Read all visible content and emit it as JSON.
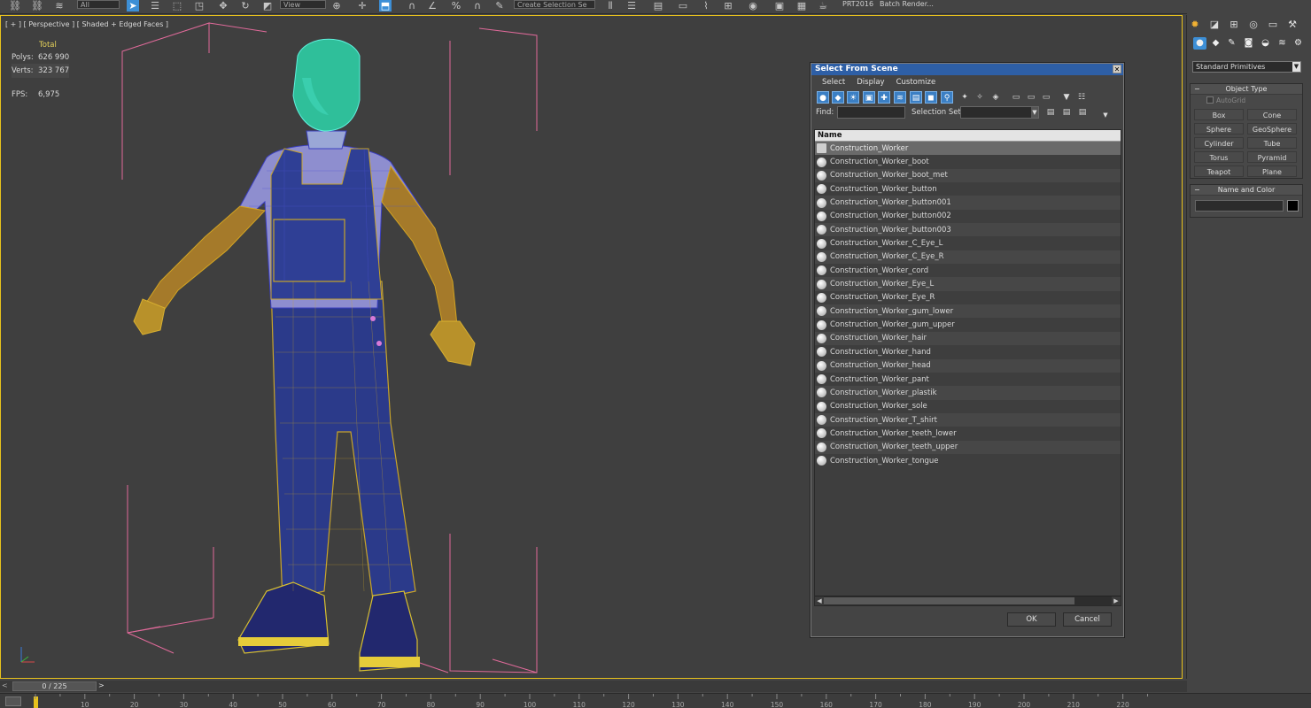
{
  "toolbar": {
    "filter_combo": "All",
    "view_combo": "View",
    "selection_set_combo": "Create Selection Se",
    "render_preset": "PRT2016",
    "batch_render": "Batch Render..."
  },
  "viewport": {
    "label_plus": "[ + ]",
    "label_view": "[ Perspective ]",
    "label_shading": "[ Shaded + Edged Faces ]",
    "stats": {
      "header": "Total",
      "polys_label": "Polys:",
      "polys_value": "626 990",
      "verts_label": "Verts:",
      "verts_value": "323 767",
      "fps_label": "FPS:",
      "fps_value": "6,975"
    },
    "axis_labels": {
      "x": "x",
      "z": "z"
    }
  },
  "dialog": {
    "title": "Select From Scene",
    "close_glyph": "✕",
    "menu": [
      "Select",
      "Display",
      "Customize"
    ],
    "find_label": "Find:",
    "find_value": "",
    "selection_set_label": "Selection Set:",
    "selection_set_value": "",
    "column_header": "Name",
    "objects": [
      "Construction_Worker",
      "Construction_Worker_boot",
      "Construction_Worker_boot_met",
      "Construction_Worker_button",
      "Construction_Worker_button001",
      "Construction_Worker_button002",
      "Construction_Worker_button003",
      "Construction_Worker_C_Eye_L",
      "Construction_Worker_C_Eye_R",
      "Construction_Worker_cord",
      "Construction_Worker_Eye_L",
      "Construction_Worker_Eye_R",
      "Construction_Worker_gum_lower",
      "Construction_Worker_gum_upper",
      "Construction_Worker_hair",
      "Construction_Worker_hand",
      "Construction_Worker_head",
      "Construction_Worker_pant",
      "Construction_Worker_plastik",
      "Construction_Worker_sole",
      "Construction_Worker_T_shirt",
      "Construction_Worker_teeth_lower",
      "Construction_Worker_teeth_upper",
      "Construction_Worker_tongue"
    ],
    "ok_label": "OK",
    "cancel_label": "Cancel"
  },
  "command_panel": {
    "category": "Standard Primitives",
    "object_type_title": "Object Type",
    "autogrid_label": "AutoGrid",
    "primitives": [
      "Box",
      "Cone",
      "Sphere",
      "GeoSphere",
      "Cylinder",
      "Tube",
      "Torus",
      "Pyramid",
      "Teapot",
      "Plane"
    ],
    "name_color_title": "Name and Color",
    "name_value": "",
    "colors": {
      "swatch": "#000000"
    }
  },
  "timeline": {
    "frame_display": "0 / 225",
    "left_arrow": "<",
    "right_arrow": ">",
    "ticks": [
      "10",
      "20",
      "30",
      "40",
      "50",
      "60",
      "70",
      "80",
      "90",
      "100",
      "110",
      "120",
      "130",
      "140",
      "150",
      "160",
      "170",
      "180",
      "190",
      "200",
      "210",
      "220"
    ]
  },
  "colors": {
    "viewport_border": "#e8c21c",
    "dialog_title_bg": "#2e5fa6",
    "stats_text": "#e6d25a",
    "bounding_box": "#e06a9a"
  }
}
